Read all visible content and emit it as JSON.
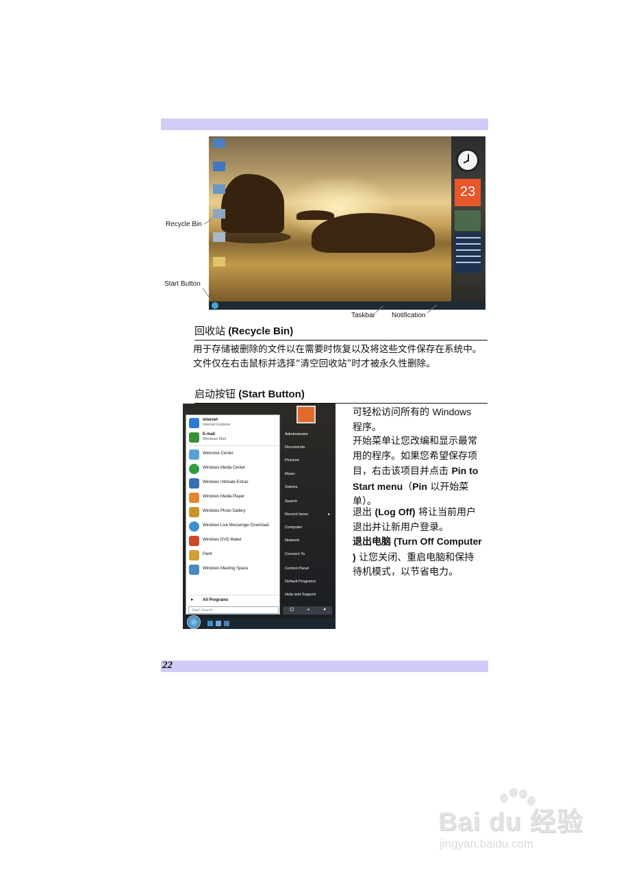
{
  "page": {
    "number": "22"
  },
  "figure1": {
    "callouts": {
      "recycle_bin": "Recycle Bin",
      "start_button": "Start Button",
      "taskbar": "Taskbar",
      "notification": "Notification"
    },
    "calendar_day": "23"
  },
  "section1": {
    "heading_cn": "回收站",
    "heading_en": "(Recycle Bin)",
    "body": "用于存储被删除的文件以在需要时恢复以及将这些文件保存在系统中。文件仅在右击鼠标并选择“清空回收站”时才被永久性删除。"
  },
  "section2": {
    "heading_cn": "启动按钮",
    "heading_en": "(Start Button)",
    "p1_a": "可轻松访问所有的 ",
    "p1_b": "Windows",
    "p1_c": "程序。",
    "p2_a": "开始菜单让您改编和显示最常用的程序。如果您希望保存项目，右击该项目并点击 ",
    "p2_b": "Pin to Start menu",
    "p2_c": "（",
    "p2_d": "Pin",
    "p2_e": " 以开始菜单）。",
    "p3_a": "退出 ",
    "p3_b": "(Log Off)",
    "p3_c": " 将让当前用户退出并让新用户登录。",
    "p4_a": "退出电脑 ",
    "p4_b": "(Turn Off Computer )",
    "p4_c": " 让您关闭、重启电脑和保持待机模式，以节省电力。"
  },
  "start_menu": {
    "pinned": [
      {
        "name": "Internet",
        "sub": "Internet Explorer",
        "icon": "internet-explorer-icon",
        "color": "#2b7bd6"
      },
      {
        "name": "E-mail",
        "sub": "Windows Mail",
        "icon": "mail-icon",
        "color": "#3a8f3a"
      }
    ],
    "recent": [
      {
        "name": "Welcome Center",
        "icon": "welcome-center-icon",
        "color": "#5aa0d8"
      },
      {
        "name": "Windows Media Center",
        "icon": "media-center-icon",
        "color": "#2f9a3e"
      },
      {
        "name": "Windows Ultimate Extras",
        "icon": "ultimate-extras-icon",
        "color": "#3b6fb3"
      },
      {
        "name": "Windows Media Player",
        "icon": "media-player-icon",
        "color": "#e3862a"
      },
      {
        "name": "Windows Photo Gallery",
        "icon": "photo-gallery-icon",
        "color": "#c9952a"
      },
      {
        "name": "Windows Live Messenger Download",
        "icon": "messenger-icon",
        "color": "#3b8fd0"
      },
      {
        "name": "Windows DVD Maker",
        "icon": "dvd-maker-icon",
        "color": "#d04a2a"
      },
      {
        "name": "Paint",
        "icon": "paint-icon",
        "color": "#d0a030"
      },
      {
        "name": "Windows Meeting Space",
        "icon": "meeting-space-icon",
        "color": "#4a8ac0"
      }
    ],
    "all_programs": "All Programs",
    "search_placeholder": "Start Search",
    "right_items": [
      "Administrator",
      "Documents",
      "Pictures",
      "Music",
      "Games",
      "Search",
      "Recent Items",
      "Computer",
      "Network",
      "Connect To",
      "Control Panel",
      "Default Programs",
      "Help and Support"
    ]
  },
  "watermark": {
    "brand": "Bai du 经验",
    "url": "jingyan.baidu.com"
  }
}
